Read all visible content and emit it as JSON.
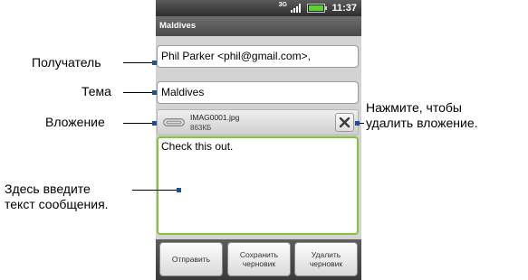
{
  "status_bar": {
    "network": "3G",
    "time": "11:37"
  },
  "title": "Maldives",
  "compose": {
    "recipient": "Phil Parker <phil@gmail.com>,",
    "subject": "Maldives",
    "attachment": {
      "filename": "IMAG0001.jpg",
      "size": "863КБ"
    },
    "body": "Check this out."
  },
  "buttons": {
    "send": "Отправить",
    "save_draft": "Сохранить\nчерновик",
    "delete_draft": "Удалить\nчерновик"
  },
  "callouts": {
    "recipient": "Получатель",
    "subject": "Тема",
    "attachment": "Вложение",
    "message_hint": "Здесь введите\nтекст сообщения.",
    "remove_attachment": "Нажмите, чтобы\nудалить вложение."
  },
  "colors": {
    "accent_green": "#86c23c",
    "callout_marker": "#1d4f9a",
    "bar_dark": "#3a3a3a"
  },
  "icons": [
    "3g-icon",
    "signal-icon",
    "battery-icon",
    "paperclip-icon",
    "close-icon"
  ]
}
